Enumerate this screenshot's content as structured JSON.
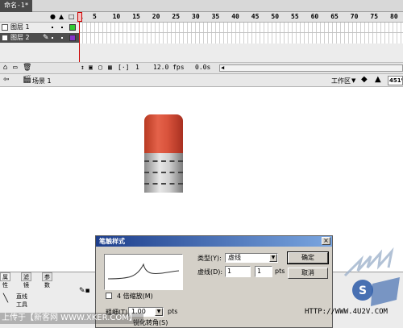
{
  "doc_tab": {
    "title": "命名-1*"
  },
  "timeline": {
    "frame_numbers": [
      "1",
      "5",
      "10",
      "15",
      "20",
      "25",
      "30",
      "35",
      "40",
      "45",
      "50",
      "55",
      "60",
      "65",
      "70",
      "75",
      "80"
    ],
    "layers": [
      {
        "name": "图层 1",
        "selected": false,
        "outline_color": "#33cc33"
      },
      {
        "name": "图层 2",
        "selected": true,
        "outline_color": "#8833cc"
      }
    ],
    "status": {
      "current_frame": "1",
      "fps": "12.0 fps",
      "time": "0.0s"
    }
  },
  "editbar": {
    "scene": "场景 1",
    "workspace": "工作区",
    "zoom": "451%"
  },
  "properties": {
    "tabs": [
      "属性",
      "滤镜",
      "参数"
    ],
    "tool_name_line1": "直线",
    "tool_name_line2": "工具",
    "pts_label": "pts"
  },
  "dialog": {
    "title": "笔触样式",
    "close": "×",
    "checkbox_label": "4 倍缩放(M)",
    "thickness_label": "粗细(T):",
    "thickness_value": "1.00",
    "thickness_unit": "pts",
    "sharp_corners_label": "锐化转角(S)",
    "type_label": "类型(Y):",
    "type_value": "虚线",
    "dash_label": "虚线(D):",
    "dash_value": "1",
    "gap_value": "1",
    "gap_unit": "pts",
    "ok_label": "确定",
    "cancel_label": "取消"
  },
  "watermark": {
    "bottom_text": "上传于【新客网 WWW.XKER.COM】",
    "url_text": "HTTP://WWW.4U2V.COM"
  },
  "colors": {
    "eraser_red": "#d9533c",
    "eraser_gray": "#cfcfcf",
    "playhead": "#cc0000",
    "dialog_title_bar": "#1d3e8c"
  }
}
